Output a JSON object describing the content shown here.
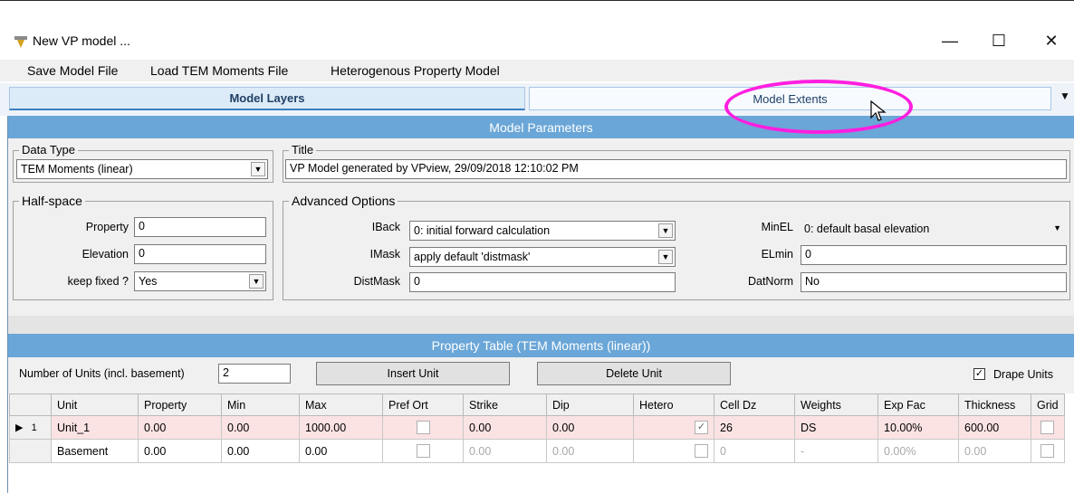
{
  "window": {
    "title": "New VP model ...",
    "minimize_glyph": "—",
    "maximize_glyph": "☐",
    "close_glyph": "✕"
  },
  "menu": [
    "Save Model File",
    "Load TEM Moments File",
    "Heterogenous Property Model"
  ],
  "tabs": [
    "Model Layers",
    "Model Extents"
  ],
  "model_parameters": {
    "header": "Model Parameters",
    "data_type": {
      "legend": "Data Type",
      "value": "TEM Moments (linear)"
    },
    "title": {
      "legend": "Title",
      "value": "VP Model generated by VPview, 29/09/2018 12:10:02 PM"
    },
    "half_space": {
      "legend": "Half-space",
      "property_label": "Property",
      "property_value": "0",
      "elevation_label": "Elevation",
      "elevation_value": "0",
      "keep_fixed_label": "keep fixed ?",
      "keep_fixed_value": "Yes"
    },
    "advanced": {
      "legend": "Advanced Options",
      "iback_label": "IBack",
      "iback_value": "0: initial forward calculation",
      "imask_label": "IMask",
      "imask_value": "apply default 'distmask'",
      "distmask_label": "DistMask",
      "distmask_value": "0",
      "minel_label": "MinEL",
      "minel_value": "0: default basal elevation",
      "elmin_label": "ELmin",
      "elmin_value": "0",
      "datnorm_label": "DatNorm",
      "datnorm_value": "No"
    }
  },
  "property_table": {
    "header": "Property Table (TEM Moments (linear))",
    "units_label": "Number of Units (incl. basement)",
    "units_value": "2",
    "insert_label": "Insert Unit",
    "delete_label": "Delete Unit",
    "drape_label": "Drape Units",
    "drape_checked": true,
    "columns": [
      "Unit",
      "Property",
      "Min",
      "Max",
      "Pref Ort",
      "Strike",
      "Dip",
      "Hetero",
      "Cell Dz",
      "Weights",
      "Exp Fac",
      "Thickness",
      "Grid"
    ],
    "rows": [
      {
        "num": "1",
        "unit": "Unit_1",
        "property": "0.00",
        "min": "0.00",
        "max": "1000.00",
        "strike": "0.00",
        "dip": "0.00",
        "hetero": true,
        "cell_dz": "26",
        "weights": "DS",
        "exp_fac": "10.00%",
        "thickness": "600.00"
      },
      {
        "num": "",
        "unit": "Basement",
        "property": "0.00",
        "min": "0.00",
        "max": "0.00",
        "strike": "0.00",
        "dip": "0.00",
        "hetero": false,
        "cell_dz": "0",
        "weights": "-",
        "exp_fac": "0.00%",
        "thickness": "0.00"
      }
    ]
  },
  "colors": {
    "accent_bar": "#6aa6d7",
    "highlight": "#ff1ee0",
    "selected_row": "#fbe3e3"
  }
}
